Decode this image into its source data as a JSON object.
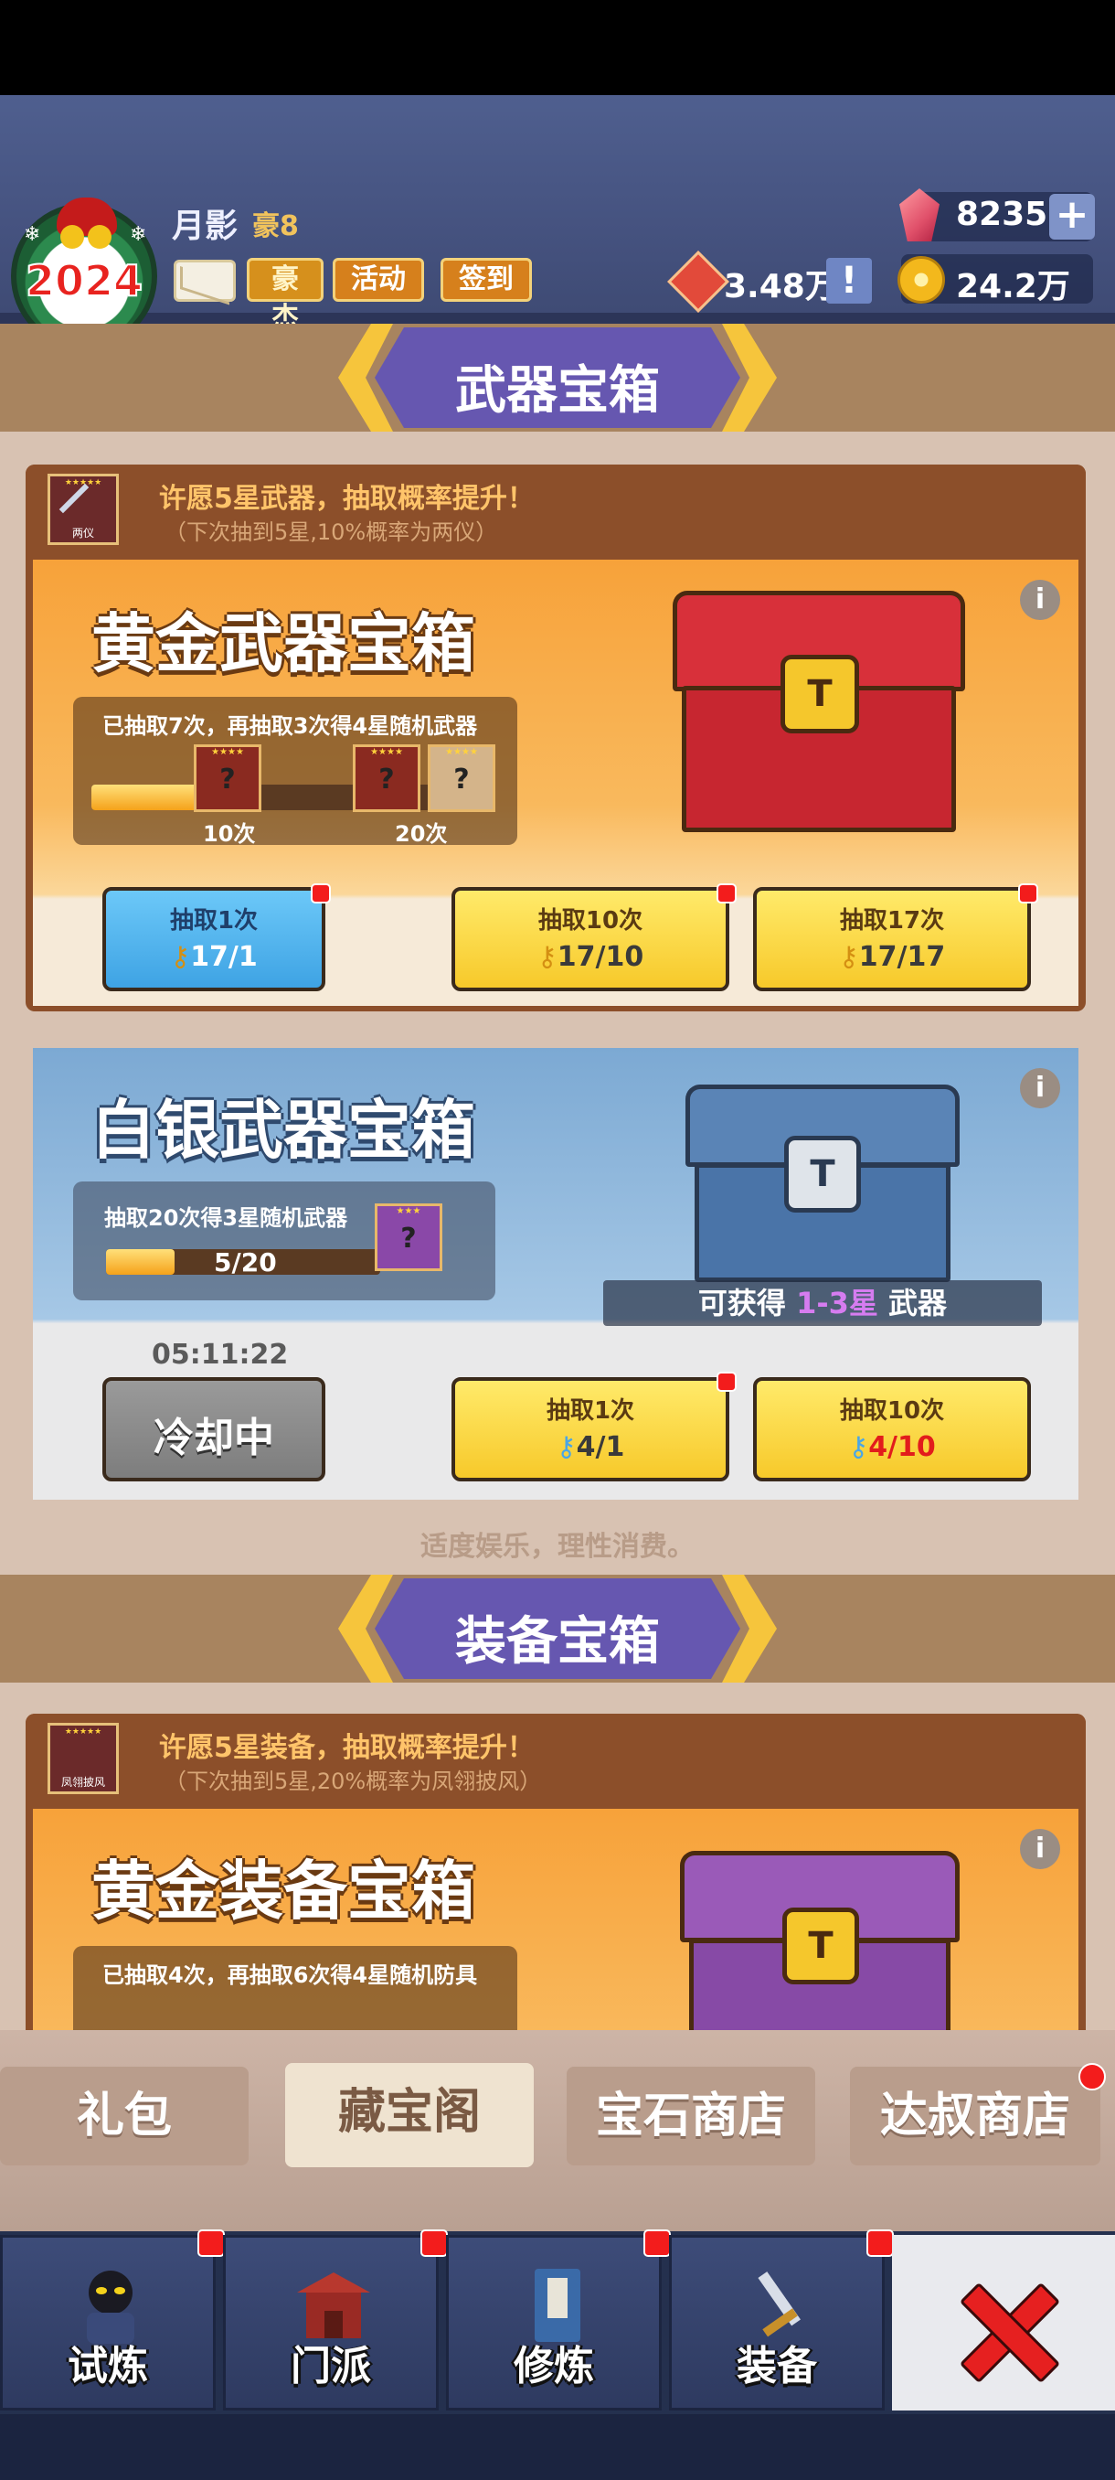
{
  "header": {
    "avatar_year": "2024",
    "username": "月影",
    "vip": "豪8",
    "tags": [
      "豪杰",
      "活动",
      "签到"
    ],
    "gems": "8235",
    "coupons": "3.48万",
    "coins": "24.2万",
    "info_symbol": "!",
    "plus_symbol": "+"
  },
  "weapon_section": {
    "title": "武器宝箱",
    "wish": {
      "icon_label": "两仪",
      "icon_stars": "★★★★★",
      "title": "许愿5星武器，抽取概率提升！",
      "subtitle": "（下次抽到5星,10%概率为两仪）"
    },
    "gold_chest": {
      "title": "黄金武器宝箱",
      "progress_text": "已抽取7次，再抽取3次得4星随机武器",
      "progress_fraction": 0.35,
      "milestones": [
        "10次",
        "20次"
      ],
      "mini_stars": "★★★★",
      "mini_q": "?",
      "buttons": [
        {
          "top": "抽取1次",
          "count": "17/1"
        },
        {
          "top": "抽取10次",
          "count": "17/10"
        },
        {
          "top": "抽取17次",
          "count": "17/17"
        }
      ]
    },
    "silver_chest": {
      "title": "白银武器宝箱",
      "progress_text": "抽取20次得3星随机武器",
      "progress_value": "5/20",
      "progress_fraction": 0.25,
      "mini_stars": "★★★",
      "mini_q": "?",
      "obtain_prefix": "可获得",
      "obtain_range": "1-3星",
      "obtain_suffix": "武器",
      "timer": "05:11:22",
      "cooldown": "冷却中",
      "buttons": [
        {
          "top": "抽取1次",
          "count": "4/1"
        },
        {
          "top": "抽取10次",
          "count": "4/10"
        }
      ]
    },
    "slogan": "适度娱乐，理性消费。"
  },
  "equipment_section": {
    "title": "装备宝箱",
    "wish": {
      "icon_label": "凤翎披风",
      "icon_stars": "★★★★★",
      "title": "许愿5星装备，抽取概率提升！",
      "subtitle": "（下次抽到5星,20%概率为凤翎披风）"
    },
    "gold_chest": {
      "title": "黄金装备宝箱",
      "progress_text": "已抽取4次，再抽取6次得4星随机防具"
    }
  },
  "shop_tabs": [
    "礼包",
    "藏宝阁",
    "宝石商店",
    "达叔商店"
  ],
  "bottom_nav": [
    "试炼",
    "门派",
    "修炼",
    "装备"
  ],
  "icon_names": [
    "mail-icon",
    "gem-icon",
    "coupon-icon",
    "coin-icon",
    "key-icon",
    "close-icon",
    "info-icon"
  ],
  "colors": {
    "accent_purple": "#6657b0",
    "gold": "#f6c53c",
    "alert_red": "#f31c1c"
  }
}
